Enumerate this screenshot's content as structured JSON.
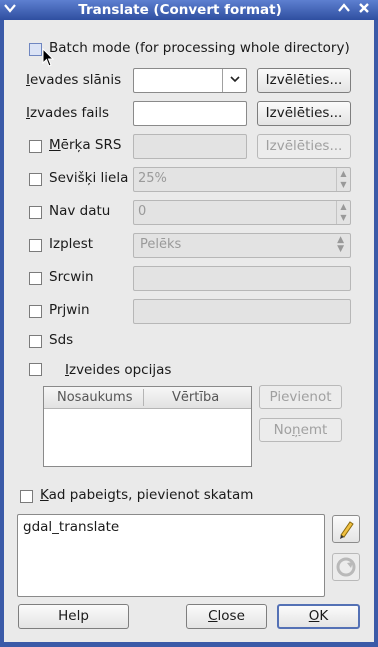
{
  "window": {
    "title": "Translate (Convert format)",
    "menu_icon": "chevron-down-icon",
    "shade_icon": "chevron-up-icon",
    "close_icon": "close-icon"
  },
  "batch_mode": {
    "label": "Batch mode (for processing whole directory)",
    "checked": false
  },
  "input_layer": {
    "label": "Ievades slānis",
    "value": "",
    "browse": "Izvēlēties..."
  },
  "output_file": {
    "label": "Izvades fails",
    "value": "",
    "browse": "Izvēlēties..."
  },
  "target_srs": {
    "label": "Mērķa SRS",
    "value": "",
    "browse": "Izvēlēties..."
  },
  "outsize": {
    "label": "Sevišķi liela",
    "value": "25%"
  },
  "nodata": {
    "label": "Nav datu",
    "value": "0"
  },
  "expand": {
    "label": "Izplest",
    "value": "Pelēks"
  },
  "srcwin": {
    "label": "Srcwin",
    "value": ""
  },
  "prjwin": {
    "label": "Prjwin",
    "value": ""
  },
  "sds": {
    "label": "Sds"
  },
  "creation_options": {
    "label": "Izveides opcijas",
    "columns": [
      "Nosaukums",
      "Vērtība"
    ],
    "add": "Pievienot",
    "remove": "Noņemt"
  },
  "load_into_canvas": {
    "label": "Kad pabeigts, pievienot skatam"
  },
  "command": {
    "text": "gdal_translate",
    "edit_icon": "pencil-icon",
    "reset_icon": "refresh-icon"
  },
  "buttons": {
    "help": "Help",
    "close": "Close",
    "ok": "OK"
  }
}
